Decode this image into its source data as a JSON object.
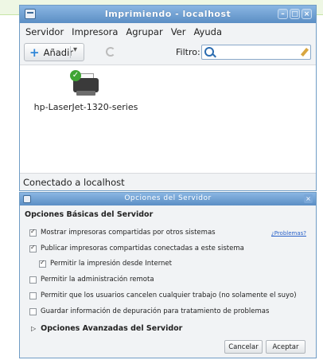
{
  "main_window": {
    "title": "Imprimiendo - localhost",
    "menu": [
      "Servidor",
      "Impresora",
      "Agrupar",
      "Ver",
      "Ayuda"
    ],
    "toolbar": {
      "add_label": "Añadir",
      "filter_label": "Filtro:",
      "filter_value": ""
    },
    "printers": [
      {
        "name": "hp-LaserJet-1320-series",
        "status_icon": "check-icon"
      }
    ],
    "status": "Conectado a localhost"
  },
  "server_dialog": {
    "title": "Opciones del Servidor",
    "section_title": "Opciones Básicas del Servidor",
    "problems_link": "¿Problemas?",
    "options": [
      {
        "label": "Mostrar impresoras compartidas por otros sistemas",
        "checked": true
      },
      {
        "label": "Publicar impresoras compartidas conectadas a este sistema",
        "checked": true
      },
      {
        "label": "Permitir la impresión desde Internet",
        "checked": true
      },
      {
        "label": "Permitir la administración remota",
        "checked": false
      },
      {
        "label": "Permitir que los usuarios cancelen cualquier trabajo (no solamente el suyo)",
        "checked": false
      },
      {
        "label": "Guardar información de depuración para tratamiento de problemas",
        "checked": false
      }
    ],
    "advanced_label": "Opciones Avanzadas del Servidor",
    "cancel_label": "Cancelar",
    "ok_label": "Aceptar"
  },
  "colors": {
    "titlebar": "#6d9ed3",
    "link": "#2a62c9",
    "accent": "#2f86d8",
    "ok_badge": "#3fa534"
  }
}
